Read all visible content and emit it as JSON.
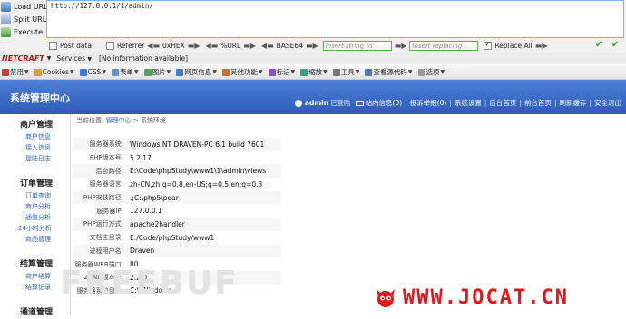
{
  "hackbar": {
    "load_url": "Load URL",
    "split_url": "Split URL",
    "execute": "Execute",
    "url_value": "http://127.0.0.1/1/admin/",
    "post_data": "Post data",
    "referrer": "Referrer",
    "hex": "0xHEX",
    "url_encode": "%URL",
    "base64": "BASE64",
    "insert_string_placeholder": "Insert string to replace",
    "insert_replacing_placeholder": "Insert replacing string",
    "replace_all": "Replace All"
  },
  "netcraft": {
    "logo": "NETCRAFT",
    "services": "Services",
    "status": "[No information available]"
  },
  "webdev_toolbar": [
    {
      "label": "禁用",
      "color": "#d13b3b"
    },
    {
      "label": "Cookies",
      "color": "#e0a020"
    },
    {
      "label": "CSS",
      "color": "#3d7bd6"
    },
    {
      "label": "表单",
      "color": "#6b8fc7"
    },
    {
      "label": "图片",
      "color": "#4fa35a"
    },
    {
      "label": "网页信息",
      "color": "#3b82c4"
    },
    {
      "label": "其他功能",
      "color": "#c96f2d"
    },
    {
      "label": "标记",
      "color": "#8f4cc2"
    },
    {
      "label": "缩放",
      "color": "#3c9c8c"
    },
    {
      "label": "工具",
      "color": "#7a7a7a"
    },
    {
      "label": "查看源代码",
      "color": "#5577aa"
    },
    {
      "label": "选项",
      "color": "#999999"
    }
  ],
  "admin": {
    "title": "系统管理中心",
    "user": "admin",
    "logged_in": "已登陆",
    "topnav": [
      "站内信息(0)",
      "投诉举报(0)",
      "系统设置",
      "后台首页",
      "前台首页",
      "刷新缓存",
      "安全退出"
    ]
  },
  "sidebar": [
    {
      "heading": "商户管理",
      "items": [
        "商户信息",
        "接入信息",
        "登陆日志"
      ]
    },
    {
      "heading": "订单管理",
      "items": [
        "订单查询",
        "商户分析",
        "通道分析",
        "24小时分析",
        "商品管理"
      ]
    },
    {
      "heading": "结算管理",
      "items": [
        "商户结算",
        "结算记录"
      ]
    },
    {
      "heading": "通道管理",
      "items": []
    }
  ],
  "breadcrumb": {
    "prefix": "当前位置:",
    "link": "管理中心",
    "sep": ">",
    "current": "系统环境"
  },
  "system_info": [
    {
      "key": "服务器系统:",
      "value": "Windows NT DRAVEN-PC 6.1 build 7601"
    },
    {
      "key": "PHP版本号:",
      "value": "5.2.17"
    },
    {
      "key": "后台路径:",
      "value": "E:\\Code\\phpStudy\\www1\\1\\admin\\views"
    },
    {
      "key": "服务器语言:",
      "value": "zh-CN,zh;q=0.8,en-US;q=0.5,en;q=0.3"
    },
    {
      "key": "PHP安装路径:",
      "value": ".;C:\\php5\\pear"
    },
    {
      "key": "服务器IP:",
      "value": "127.0.0.1"
    },
    {
      "key": "PHP运行方式:",
      "value": "apache2handler"
    },
    {
      "key": "文档主目录:",
      "value": "E:/Code/phpStudy/www1"
    },
    {
      "key": "进程用户名:",
      "value": "Draven"
    },
    {
      "key": "服务器WEB端口:",
      "value": "80"
    },
    {
      "key": "ZEND版本号:",
      "value": "2.2.0"
    },
    {
      "key": "服务器系统目录:",
      "value": "C:\\\\Windows"
    }
  ],
  "watermarks": {
    "freebuf": "FREEBUF",
    "jocat": "WWW.JOCAT.CN"
  }
}
